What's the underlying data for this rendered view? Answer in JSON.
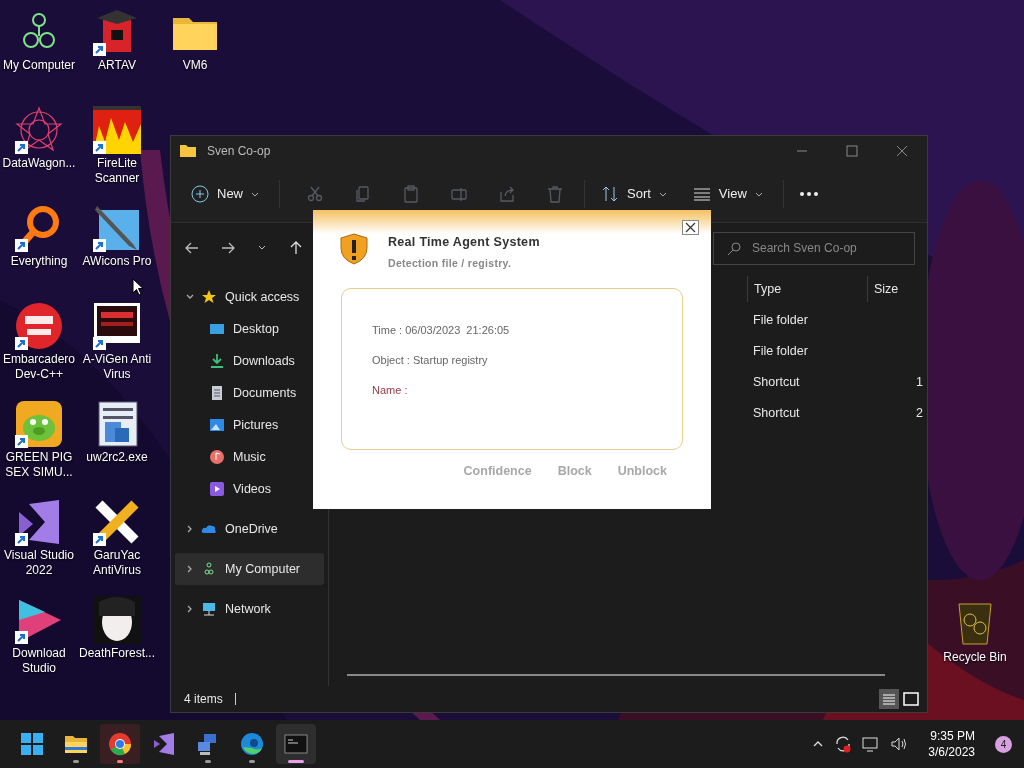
{
  "desktop": {
    "icons": [
      {
        "label": "My Computer",
        "shortcut": false
      },
      {
        "label": "DataWagon...",
        "shortcut": true
      },
      {
        "label": "Everything",
        "shortcut": true
      },
      {
        "label": "Embarcadero Dev-C++",
        "shortcut": true
      },
      {
        "label": "GREEN PIG SEX SIMU...",
        "shortcut": true
      },
      {
        "label": "Visual Studio 2022",
        "shortcut": true
      },
      {
        "label": "Download Studio",
        "shortcut": true
      },
      {
        "label": "ARTAV",
        "shortcut": true
      },
      {
        "label": "FireLite Scanner",
        "shortcut": true
      },
      {
        "label": "AWicons Pro",
        "shortcut": true
      },
      {
        "label": "A-ViGen Anti Virus",
        "shortcut": true
      },
      {
        "label": "uw2rc2.exe",
        "shortcut": false
      },
      {
        "label": "GaruYac AntiVirus",
        "shortcut": true
      },
      {
        "label": "DeathForest...",
        "shortcut": false
      },
      {
        "label": "VM6",
        "shortcut": false
      }
    ],
    "recycle_bin": {
      "label": "Recycle Bin"
    }
  },
  "explorer": {
    "title": "Sven Co-op",
    "toolbar": {
      "new": "New",
      "sort": "Sort",
      "view": "View"
    },
    "search": {
      "placeholder": "Search Sven Co-op"
    },
    "nav": [
      {
        "label": "Quick access",
        "expanded": true,
        "selected": false,
        "children": [
          {
            "label": "Desktop",
            "selected": false
          },
          {
            "label": "Downloads",
            "selected": false
          },
          {
            "label": "Documents",
            "selected": false
          },
          {
            "label": "Pictures",
            "selected": false
          },
          {
            "label": "Music",
            "selected": false
          },
          {
            "label": "Videos",
            "selected": false
          }
        ]
      },
      {
        "label": "OneDrive",
        "expanded": false,
        "selected": false
      },
      {
        "label": "My Computer",
        "expanded": false,
        "selected": true
      },
      {
        "label": "Network",
        "expanded": false,
        "selected": false
      }
    ],
    "columns": [
      "Type",
      "Size"
    ],
    "rows": [
      {
        "type": "File folder"
      },
      {
        "type": "File folder"
      },
      {
        "type": "Shortcut",
        "size": "1"
      },
      {
        "type": "Shortcut",
        "size": "2"
      }
    ],
    "status": "4 items"
  },
  "dialog": {
    "title": "Real Time Agent System",
    "subtitle": "Detection file / registry.",
    "fields": [
      {
        "text": "Time : 06/03/2023  21:26:05",
        "kind": "info"
      },
      {
        "text": "Object : Startup registry",
        "kind": "info"
      },
      {
        "text": "Name :",
        "kind": "alert"
      }
    ],
    "buttons": [
      "Confidence",
      "Block",
      "Unblock"
    ]
  },
  "taskbar": {
    "apps": [
      {
        "running": false,
        "active": false,
        "attention": false
      },
      {
        "running": true,
        "active": false,
        "attention": false
      },
      {
        "running": true,
        "active": false,
        "attention": true
      },
      {
        "running": false,
        "active": false,
        "attention": false
      },
      {
        "running": true,
        "active": false,
        "attention": false
      },
      {
        "running": true,
        "active": false,
        "attention": false
      },
      {
        "running": true,
        "active": true,
        "attention": false
      }
    ],
    "time": "9:35 PM",
    "date": "3/6/2023",
    "notifications": "4"
  }
}
